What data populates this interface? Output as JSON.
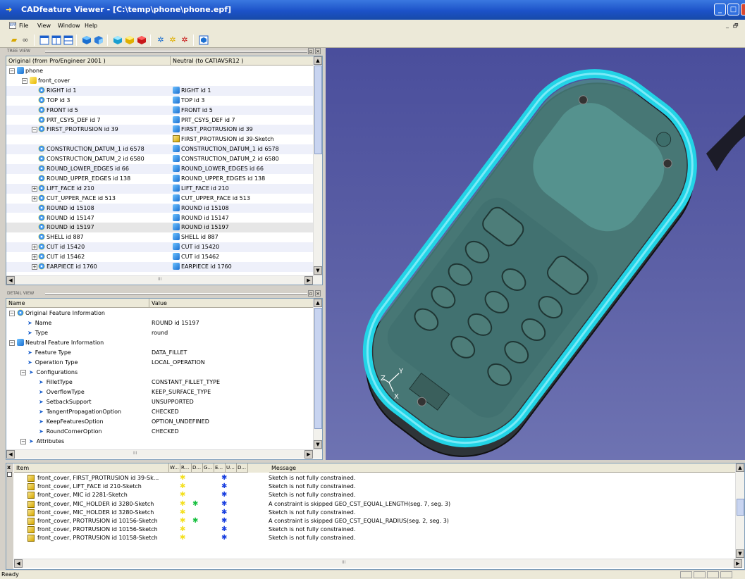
{
  "window": {
    "title": "CADfeature Viewer - [C:\\temp\\phone\\phone.epf]",
    "min_label": "_",
    "max_label": "□",
    "close_label": "X"
  },
  "menu": {
    "items": [
      "File",
      "View",
      "Window",
      "Help"
    ],
    "mdi_min": "_",
    "mdi_restore": "🗗"
  },
  "toolbar": {
    "icons": [
      "open-folder-icon",
      "binoculars-icon",
      "window-icon",
      "window-split-icon",
      "window-stack-icon",
      "blue-cube-icon",
      "blue-cube-alt-icon",
      "cyan-cube-icon",
      "yellow-cube-icon",
      "red-cube-icon",
      "blue-gear-icon",
      "yellow-gear-icon",
      "red-gear-icon",
      "fit-view-icon"
    ]
  },
  "tree_view": {
    "panel_label": "TREE VIEW",
    "col1": "Original (from Pro/Engineer 2001 )",
    "col2": "Neutral (to CATIAV5R12 )",
    "root": "phone",
    "part": "front_cover",
    "rows": [
      {
        "orig": "RIGHT id 1",
        "neutral": "RIGHT id 1",
        "exp": ""
      },
      {
        "orig": "TOP id 3",
        "neutral": "TOP id 3",
        "exp": ""
      },
      {
        "orig": "FRONT id 5",
        "neutral": "FRONT id 5",
        "exp": ""
      },
      {
        "orig": "PRT_CSYS_DEF id 7",
        "neutral": "PRT_CSYS_DEF id 7",
        "exp": ""
      },
      {
        "orig": "FIRST_PROTRUSION id 39",
        "neutral": "FIRST_PROTRUSION id 39",
        "exp": "-"
      },
      {
        "orig": "",
        "neutral": "FIRST_PROTRUSION id 39-Sketch",
        "exp": ""
      },
      {
        "orig": "CONSTRUCTION_DATUM_1 id 6578",
        "neutral": "CONSTRUCTION_DATUM_1 id 6578",
        "exp": ""
      },
      {
        "orig": "CONSTRUCTION_DATUM_2 id 6580",
        "neutral": "CONSTRUCTION_DATUM_2 id 6580",
        "exp": ""
      },
      {
        "orig": "ROUND_LOWER_EDGES id 66",
        "neutral": "ROUND_LOWER_EDGES id 66",
        "exp": ""
      },
      {
        "orig": "ROUND_UPPER_EDGES id 138",
        "neutral": "ROUND_UPPER_EDGES id 138",
        "exp": ""
      },
      {
        "orig": "LIFT_FACE id 210",
        "neutral": "LIFT_FACE id 210",
        "exp": "+"
      },
      {
        "orig": "CUT_UPPER_FACE id 513",
        "neutral": "CUT_UPPER_FACE id 513",
        "exp": "+"
      },
      {
        "orig": "ROUND id 15108",
        "neutral": "ROUND id 15108",
        "exp": ""
      },
      {
        "orig": "ROUND id 15147",
        "neutral": "ROUND id 15147",
        "exp": ""
      },
      {
        "orig": "ROUND id 15197",
        "neutral": "ROUND id 15197",
        "exp": ""
      },
      {
        "orig": "SHELL id 887",
        "neutral": "SHELL id 887",
        "exp": ""
      },
      {
        "orig": "CUT id 15420",
        "neutral": "CUT id 15420",
        "exp": "+"
      },
      {
        "orig": "CUT id 15462",
        "neutral": "CUT id 15462",
        "exp": "+"
      },
      {
        "orig": "EARPIECE id 1760",
        "neutral": "EARPIECE id 1760",
        "exp": "+"
      }
    ],
    "hscroll_label": "III"
  },
  "detail_view": {
    "panel_label": "DETAIL VIEW",
    "col1": "Name",
    "col2": "Value",
    "rows": [
      {
        "name": "Original Feature Information",
        "value": "",
        "level": 0,
        "kind": "group"
      },
      {
        "name": "Name",
        "value": "ROUND id 15197",
        "level": 1,
        "kind": "prop"
      },
      {
        "name": "Type",
        "value": "round",
        "level": 1,
        "kind": "prop"
      },
      {
        "name": "Neutral Feature Information",
        "value": "",
        "level": 0,
        "kind": "group2"
      },
      {
        "name": "Feature Type",
        "value": "DATA_FILLET",
        "level": 1,
        "kind": "prop"
      },
      {
        "name": "Operation Type",
        "value": "LOCAL_OPERATION",
        "level": 1,
        "kind": "prop"
      },
      {
        "name": "Configurations",
        "value": "",
        "level": 1,
        "kind": "sub"
      },
      {
        "name": "FilletType",
        "value": "CONSTANT_FILLET_TYPE",
        "level": 2,
        "kind": "prop"
      },
      {
        "name": "OverflowType",
        "value": "KEEP_SURFACE_TYPE",
        "level": 2,
        "kind": "prop"
      },
      {
        "name": "SetbackSupport",
        "value": "UNSUPPORTED",
        "level": 2,
        "kind": "prop"
      },
      {
        "name": "TangentPropagationOption",
        "value": "CHECKED",
        "level": 2,
        "kind": "prop"
      },
      {
        "name": "KeepFeaturesOption",
        "value": "OPTION_UNDEFINED",
        "level": 2,
        "kind": "prop"
      },
      {
        "name": "RoundCornerOption",
        "value": "CHECKED",
        "level": 2,
        "kind": "prop"
      },
      {
        "name": "Attributes",
        "value": "",
        "level": 1,
        "kind": "sub"
      }
    ],
    "hscroll_label": "III"
  },
  "viewport": {
    "axis_x": "X",
    "axis_y": "Y",
    "axis_z": "Z"
  },
  "messages": {
    "close_label": "x",
    "columns": [
      "Item",
      "W...",
      "R...",
      "D...",
      "G...",
      "E...",
      "U...",
      "D...",
      "Message"
    ],
    "rows": [
      {
        "item": "front_cover, FIRST_PROTRUSION id 39-Sk...",
        "r": true,
        "d": false,
        "e": true,
        "msg": "Sketch is not fully constrained."
      },
      {
        "item": "front_cover, LIFT_FACE id 210-Sketch",
        "r": true,
        "d": false,
        "e": true,
        "msg": "Sketch is not fully constrained."
      },
      {
        "item": "front_cover, MIC id 2281-Sketch",
        "r": true,
        "d": false,
        "e": true,
        "msg": "Sketch is not fully constrained."
      },
      {
        "item": "front_cover, MIC_HOLDER id 3280-Sketch",
        "r": true,
        "d": true,
        "e": true,
        "msg": "A constraint is skipped  GEO_CST_EQUAL_LENGTH(seg. 7, seg. 3)"
      },
      {
        "item": "front_cover, MIC_HOLDER id 3280-Sketch",
        "r": true,
        "d": false,
        "e": true,
        "msg": "Sketch is not fully constrained."
      },
      {
        "item": "front_cover, PROTRUSION id 10156-Sketch",
        "r": true,
        "d": true,
        "e": true,
        "msg": "A constraint is skipped  GEO_CST_EQUAL_RADIUS(seg. 2, seg. 3)"
      },
      {
        "item": "front_cover, PROTRUSION id 10156-Sketch",
        "r": true,
        "d": false,
        "e": true,
        "msg": "Sketch is not fully constrained."
      },
      {
        "item": "front_cover, PROTRUSION id 10158-Sketch",
        "r": true,
        "d": false,
        "e": true,
        "msg": "Sketch is not fully constrained."
      }
    ],
    "hscroll_label": "III"
  },
  "status": {
    "text": "Ready"
  },
  "colors": {
    "title_blue": "#1c52c8",
    "selection_gray": "#e6e6e6",
    "viewport_bg": "#5b5fa5",
    "phone_cyan": "#22d4e6",
    "star_yellow": "#f4e020",
    "star_green": "#18c040",
    "star_blue": "#1a40e0"
  }
}
